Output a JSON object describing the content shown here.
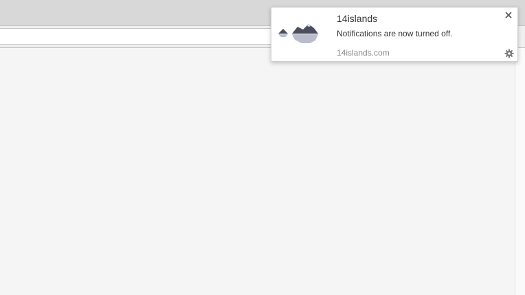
{
  "notification": {
    "title": "14islands",
    "message": "Notifications are now turned off.",
    "origin": "14islands.com",
    "icon": "islands-logo-icon",
    "close_icon": "close-icon",
    "settings_icon": "gear-icon"
  },
  "colors": {
    "accent": "#4a4e5e",
    "text": "#333333",
    "muted": "#8a8a8a"
  }
}
